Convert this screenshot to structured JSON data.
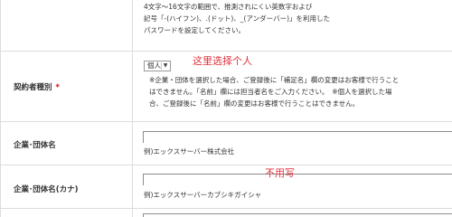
{
  "password_row": {
    "hint_lines": [
      "4文字～16文字の範囲で、推測されにくい英数字および",
      "記号「-(ハイフン)、.(ドット)、_(アンダーバー)」を利用した",
      "パスワードを設定してください。"
    ]
  },
  "contract_type_row": {
    "label": "契約者種別",
    "required_mark": "*",
    "selected": "個人",
    "annotation": "这里选择个人",
    "notes": [
      "※企業・団体を選択した場合、ご登録後に「補足名」欄の変更はお客様で行うこと",
      "はできません。「名前」欄には担当者名をご入力ください。　※個人を選択した場",
      "合、ご登録後に「名前」欄の変更はお客様で行うことはできません。"
    ]
  },
  "company_name_row": {
    "label": "企業･団体名",
    "example": "例)エックスサーバー株式会社"
  },
  "company_kana_row": {
    "label": "企業･団体名(カナ)",
    "annotation": "不用写",
    "example": "例)エックスサーバーカブシキガイシャ"
  },
  "colors": {
    "annotation": "#e0323c",
    "required": "#d9000c",
    "border": "#dcdcdc"
  }
}
